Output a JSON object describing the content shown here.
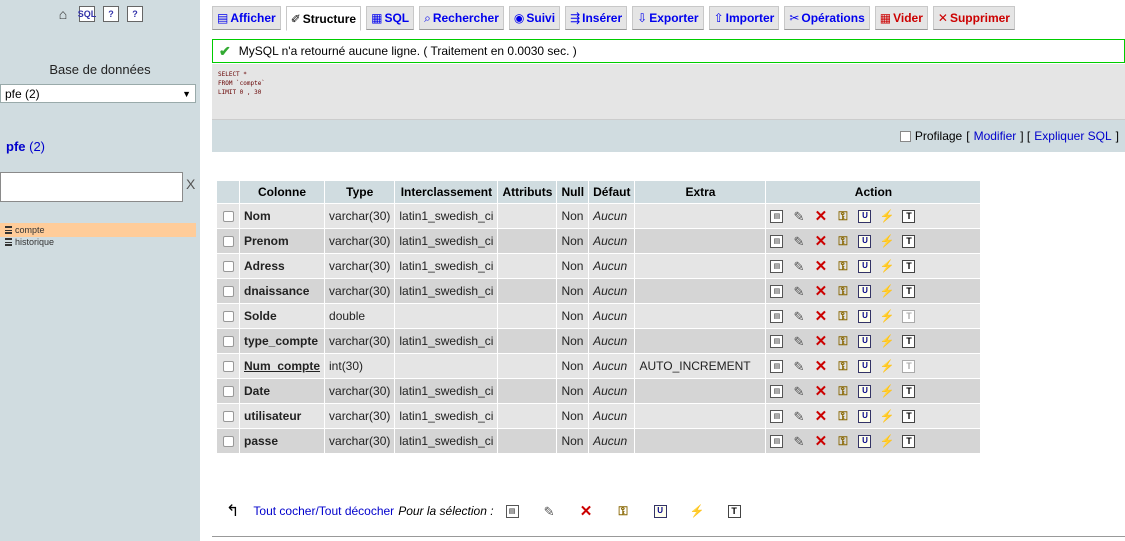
{
  "left": {
    "icons": [
      "home-icon",
      "sql-query-icon",
      "docs-icon",
      "help-icon"
    ],
    "db_label": "Base de données",
    "db_select": "pfe (2)",
    "db_heading_name": "pfe",
    "db_heading_count": "(2)",
    "filter_clear": "X",
    "tables": [
      {
        "name": "compte",
        "active": true
      },
      {
        "name": "historique",
        "active": false
      }
    ]
  },
  "tabs": [
    {
      "label": "Afficher",
      "icon": "browse-icon",
      "active": false
    },
    {
      "label": "Structure",
      "icon": "structure-icon",
      "active": true
    },
    {
      "label": "SQL",
      "icon": "sql-icon",
      "active": false
    },
    {
      "label": "Rechercher",
      "icon": "search-icon",
      "active": false
    },
    {
      "label": "Suivi",
      "icon": "tracking-icon",
      "active": false
    },
    {
      "label": "Insérer",
      "icon": "insert-icon",
      "active": false
    },
    {
      "label": "Exporter",
      "icon": "export-icon",
      "active": false
    },
    {
      "label": "Importer",
      "icon": "import-icon",
      "active": false
    },
    {
      "label": "Opérations",
      "icon": "operations-icon",
      "active": false
    },
    {
      "label": "Vider",
      "icon": "empty-icon",
      "active": false,
      "color": "#cc0000"
    },
    {
      "label": "Supprimer",
      "icon": "drop-icon",
      "active": false,
      "color": "#cc0000"
    }
  ],
  "message": "MySQL n'a retourné aucune ligne. ( Traitement en 0.0030 sec. )",
  "sql_query": "SELECT *\nFROM `compte`\nLIMIT 0 , 30",
  "profil": {
    "checkbox_label": "Profilage",
    "modifier": "Modifier",
    "expliquer": "Expliquer SQL"
  },
  "table": {
    "headers": [
      "Colonne",
      "Type",
      "Interclassement",
      "Attributs",
      "Null",
      "Défaut",
      "Extra",
      "Action"
    ],
    "rows": [
      {
        "name": "Nom",
        "type": "varchar(30)",
        "collation": "latin1_swedish_ci",
        "attributes": "",
        "null": "Non",
        "default": "Aucun",
        "extra": "",
        "primary": false,
        "fulltext_enabled": true
      },
      {
        "name": "Prenom",
        "type": "varchar(30)",
        "collation": "latin1_swedish_ci",
        "attributes": "",
        "null": "Non",
        "default": "Aucun",
        "extra": "",
        "primary": false,
        "fulltext_enabled": true
      },
      {
        "name": "Adress",
        "type": "varchar(30)",
        "collation": "latin1_swedish_ci",
        "attributes": "",
        "null": "Non",
        "default": "Aucun",
        "extra": "",
        "primary": false,
        "fulltext_enabled": true
      },
      {
        "name": "dnaissance",
        "type": "varchar(30)",
        "collation": "latin1_swedish_ci",
        "attributes": "",
        "null": "Non",
        "default": "Aucun",
        "extra": "",
        "primary": false,
        "fulltext_enabled": true
      },
      {
        "name": "Solde",
        "type": "double",
        "collation": "",
        "attributes": "",
        "null": "Non",
        "default": "Aucun",
        "extra": "",
        "primary": false,
        "fulltext_enabled": false
      },
      {
        "name": "type_compte",
        "type": "varchar(30)",
        "collation": "latin1_swedish_ci",
        "attributes": "",
        "null": "Non",
        "default": "Aucun",
        "extra": "",
        "primary": false,
        "fulltext_enabled": true
      },
      {
        "name": "Num_compte",
        "type": "int(30)",
        "collation": "",
        "attributes": "",
        "null": "Non",
        "default": "Aucun",
        "extra": "AUTO_INCREMENT",
        "primary": true,
        "fulltext_enabled": false
      },
      {
        "name": "Date",
        "type": "varchar(30)",
        "collation": "latin1_swedish_ci",
        "attributes": "",
        "null": "Non",
        "default": "Aucun",
        "extra": "",
        "primary": false,
        "fulltext_enabled": true
      },
      {
        "name": "utilisateur",
        "type": "varchar(30)",
        "collation": "latin1_swedish_ci",
        "attributes": "",
        "null": "Non",
        "default": "Aucun",
        "extra": "",
        "primary": false,
        "fulltext_enabled": true
      },
      {
        "name": "passe",
        "type": "varchar(30)",
        "collation": "latin1_swedish_ci",
        "attributes": "",
        "null": "Non",
        "default": "Aucun",
        "extra": "",
        "primary": false,
        "fulltext_enabled": true
      }
    ],
    "row_actions": [
      "browse-icon",
      "edit-icon",
      "drop-icon",
      "primary-key-icon",
      "unique-icon",
      "index-icon",
      "fulltext-icon"
    ]
  },
  "bottom": {
    "check_all": "Tout cocher",
    "separator": " / ",
    "uncheck_all": "Tout décocher",
    "selection_label": "Pour la sélection :"
  }
}
